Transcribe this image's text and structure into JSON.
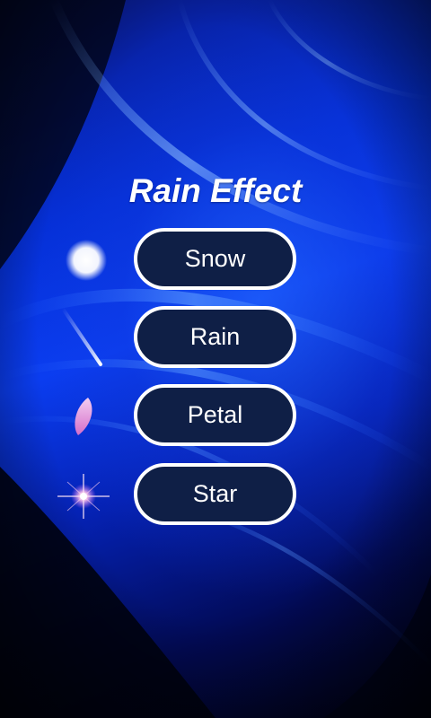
{
  "app": {
    "title": "Rain Effect"
  },
  "menu": {
    "items": [
      {
        "label": "Snow",
        "icon": "snowball-icon"
      },
      {
        "label": "Rain",
        "icon": "raindrop-streak-icon"
      },
      {
        "label": "Petal",
        "icon": "petal-icon"
      },
      {
        "label": "Star",
        "icon": "sparkle-star-icon"
      }
    ]
  },
  "colors": {
    "button_fill": "#0f1f46",
    "button_border": "#ffffff",
    "text": "#ffffff",
    "background_accent": "#0b3df0"
  }
}
